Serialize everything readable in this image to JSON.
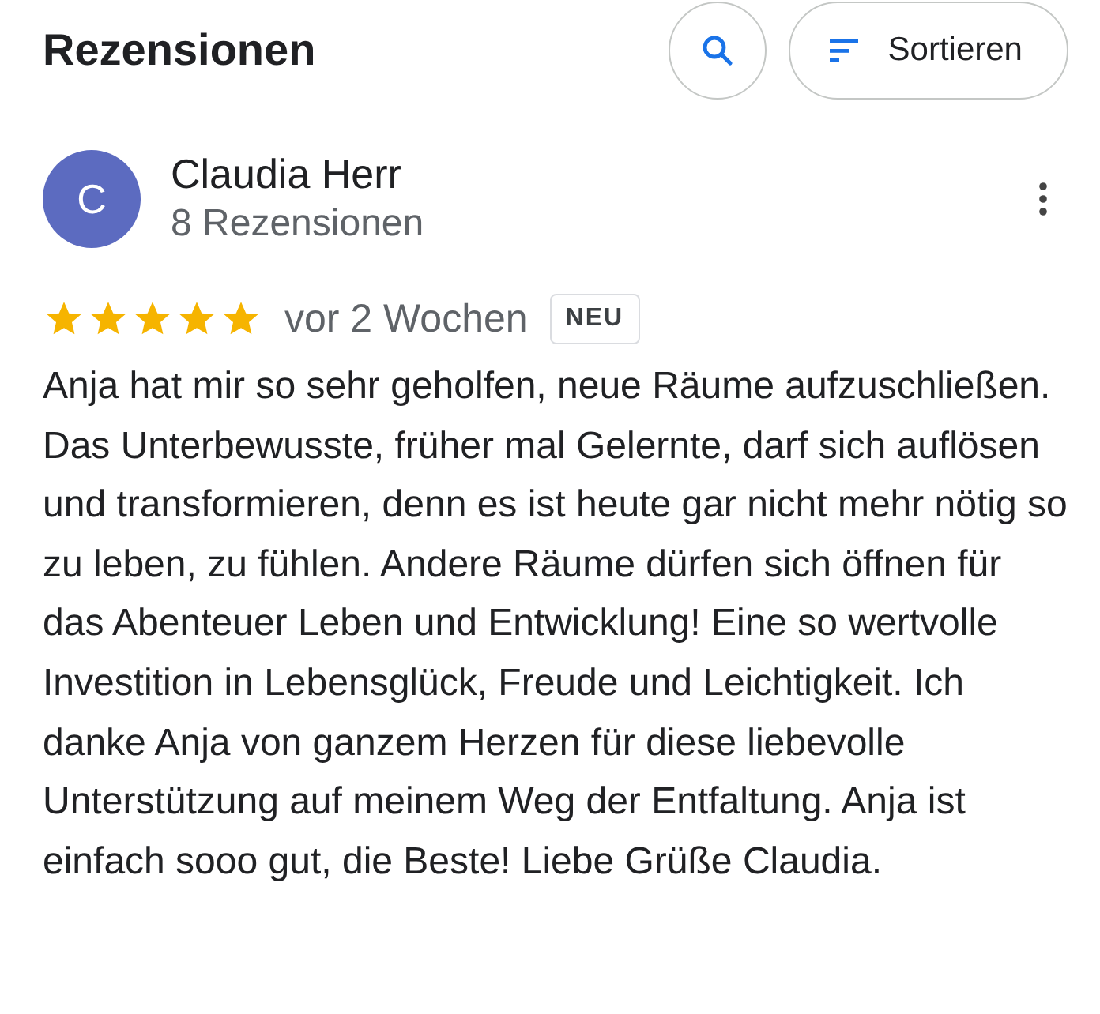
{
  "header": {
    "title": "Rezensionen",
    "sort_label": "Sortieren"
  },
  "review": {
    "avatar_letter": "C",
    "name": "Claudia Herr",
    "count": "8 Rezensionen",
    "stars": 5,
    "time": "vor 2 Wochen",
    "badge": "NEU",
    "text": "Anja hat mir so sehr geholfen, neue Räume aufzuschließen. Das Unterbewusste, früher mal Gelernte, darf sich auflösen und transformieren, denn es ist heute gar nicht mehr nötig so zu leben, zu fühlen. Andere Räume dürfen sich öffnen für das Abenteuer Leben und Entwicklung! Eine so wertvolle Investition in Lebensglück, Freude und Leichtigkeit. Ich danke Anja von ganzem Herzen für diese liebevolle Unterstützung auf meinem Weg der Entfaltung. Anja ist einfach sooo gut, die Beste! Liebe Grüße Claudia."
  }
}
